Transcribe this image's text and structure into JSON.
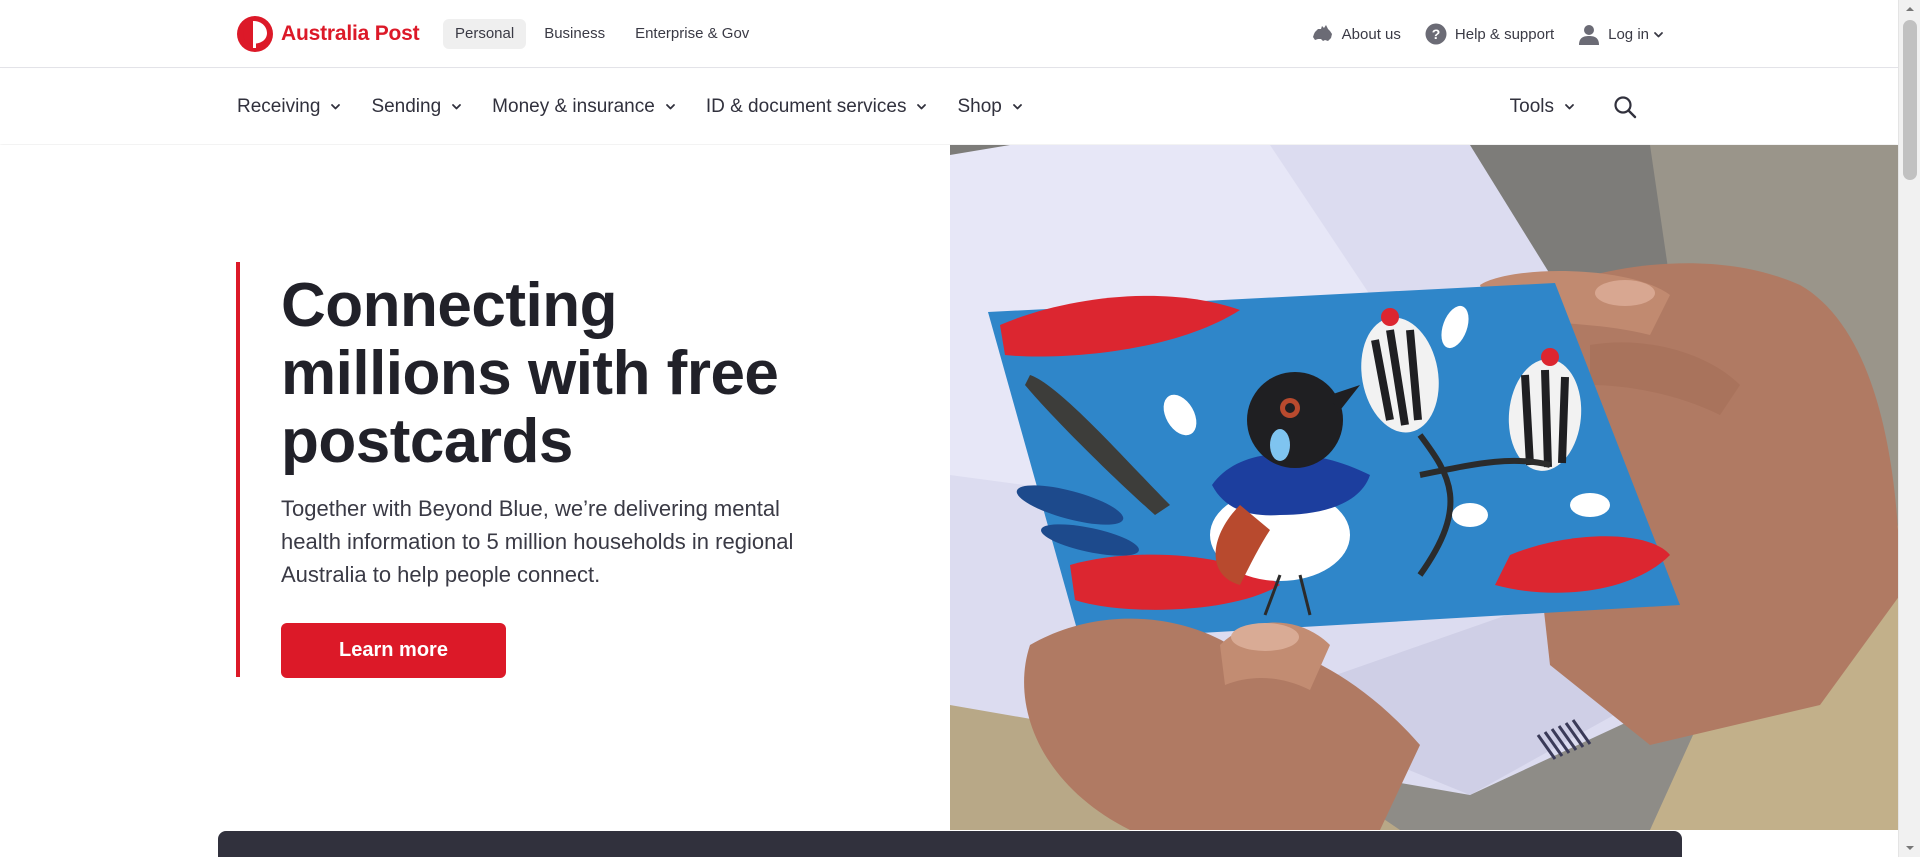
{
  "brand": {
    "name": "Australia Post",
    "color": "#dc1928"
  },
  "segments": [
    {
      "label": "Personal",
      "active": true
    },
    {
      "label": "Business",
      "active": false
    },
    {
      "label": "Enterprise & Gov",
      "active": false
    }
  ],
  "utility": {
    "about": "About us",
    "help": "Help & support",
    "login": "Log in"
  },
  "nav": {
    "items": [
      {
        "label": "Receiving"
      },
      {
        "label": "Sending"
      },
      {
        "label": "Money & insurance"
      },
      {
        "label": "ID & document services"
      },
      {
        "label": "Shop"
      }
    ],
    "tools": "Tools"
  },
  "hero": {
    "title": "Connecting millions with free postcards",
    "body": "Together with Beyond Blue, we’re delivering mental health information to 5 million households in regional Australia to help people connect.",
    "cta": "Learn more",
    "image": "hands-holding-illustrated-bird-postcard"
  },
  "icons": {
    "logo": "australia-post-logo-icon",
    "about": "australia-map-icon",
    "help": "question-circle-icon",
    "user": "user-icon",
    "chevron": "chevron-down-icon",
    "search": "search-icon"
  }
}
